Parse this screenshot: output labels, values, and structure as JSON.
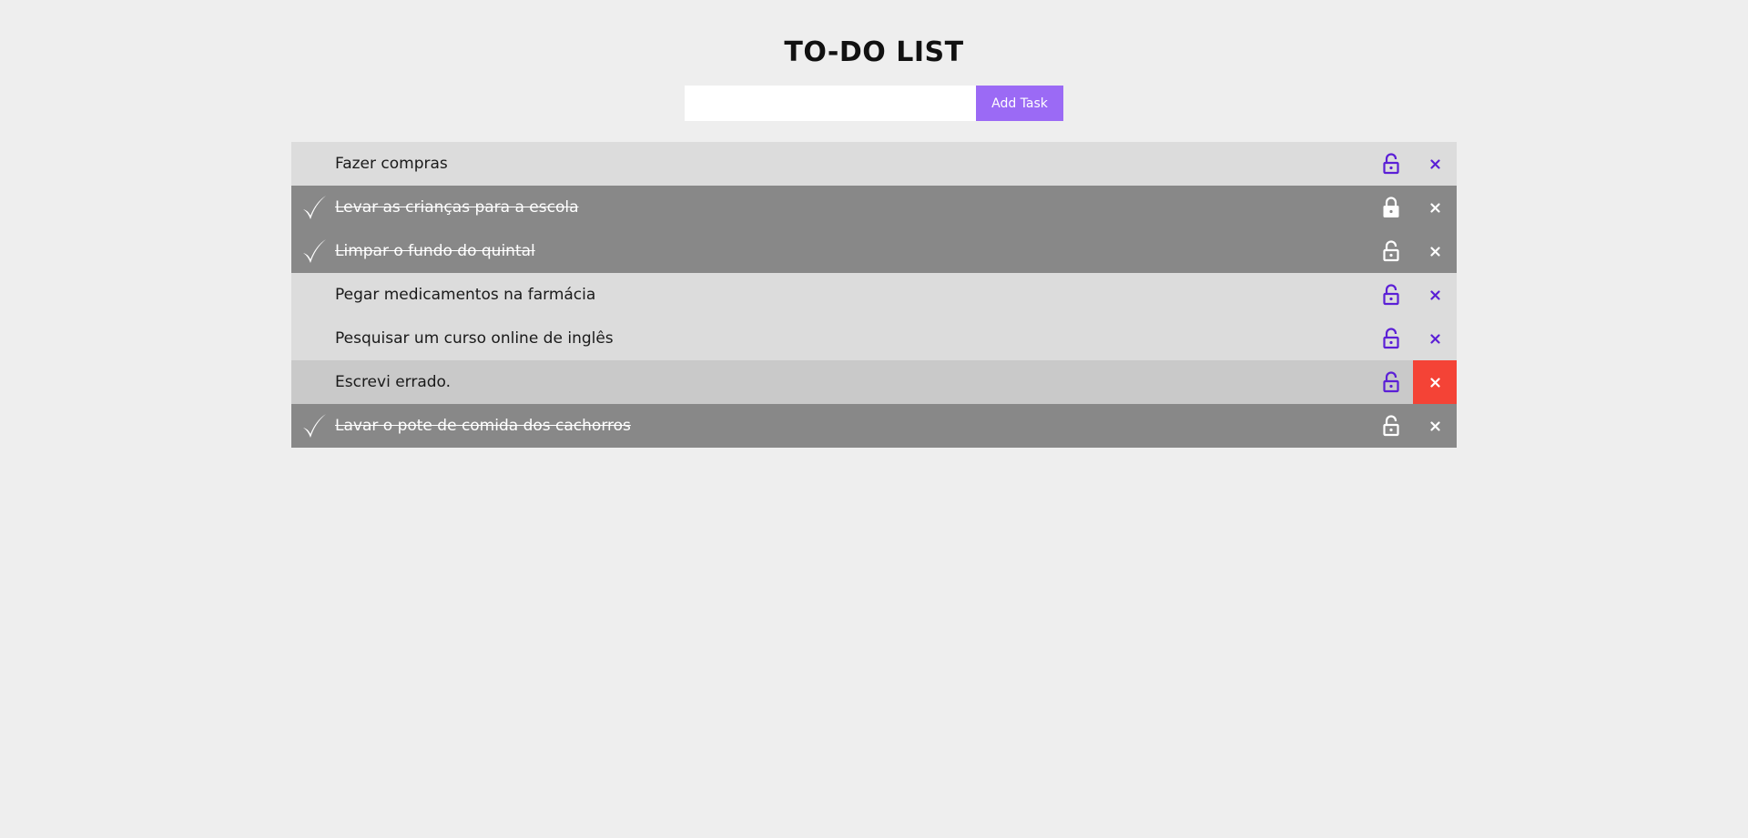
{
  "title": "TO-DO LIST",
  "form": {
    "input_value": "",
    "button_label": "Add Task"
  },
  "colors": {
    "background": "#eeeeee",
    "accent": "#9b6af5",
    "icon_purple": "#5b1fd6",
    "done_row": "#888888",
    "row": "#dcdcdc",
    "delete_hover": "#f44336"
  },
  "icons": {
    "check": "check-icon",
    "lock": "lock-icon",
    "delete": "close-icon"
  },
  "tasks": [
    {
      "text": "Fazer compras",
      "done": false,
      "locked": false,
      "hover": false
    },
    {
      "text": "Levar as crianças para a escola",
      "done": true,
      "locked": true,
      "hover": false
    },
    {
      "text": "Limpar o fundo do quintal",
      "done": true,
      "locked": false,
      "hover": false
    },
    {
      "text": "Pegar medicamentos na farmácia",
      "done": false,
      "locked": false,
      "hover": false
    },
    {
      "text": "Pesquisar um curso online de inglês",
      "done": false,
      "locked": false,
      "hover": false
    },
    {
      "text": "Escrevi errado.",
      "done": false,
      "locked": false,
      "hover": true
    },
    {
      "text": "Lavar o pote de comida dos cachorros",
      "done": true,
      "locked": false,
      "hover": false
    }
  ]
}
